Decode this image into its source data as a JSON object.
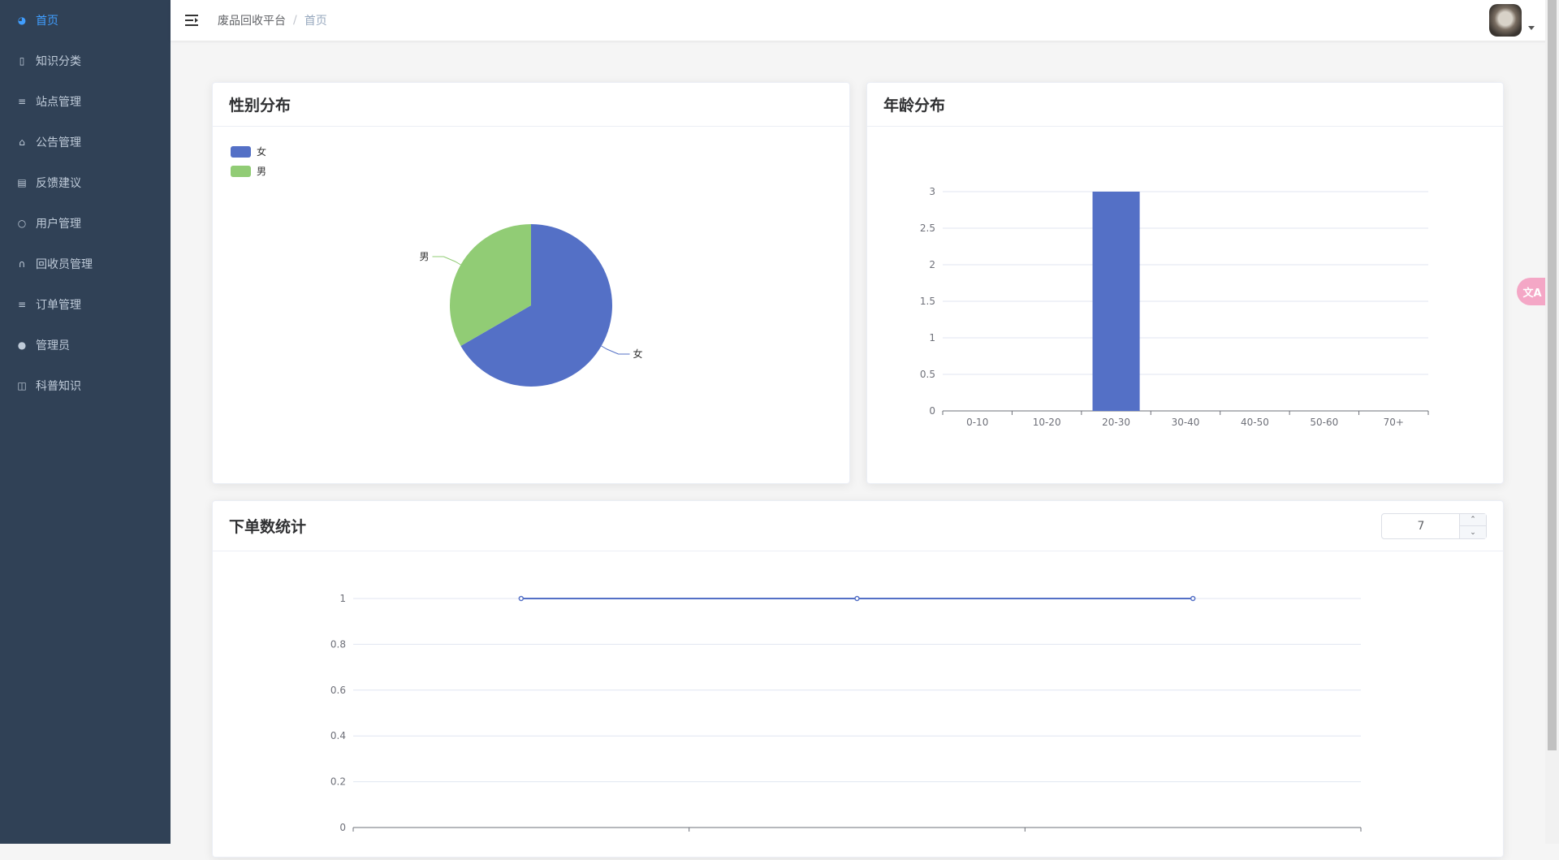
{
  "sidebar": {
    "items": [
      {
        "label": "首页",
        "icon": "dashboard-icon",
        "active": true
      },
      {
        "label": "知识分类",
        "icon": "book-icon",
        "active": false
      },
      {
        "label": "站点管理",
        "icon": "sliders-icon",
        "active": false
      },
      {
        "label": "公告管理",
        "icon": "box-icon",
        "active": false
      },
      {
        "label": "反馈建议",
        "icon": "message-icon",
        "active": false
      },
      {
        "label": "用户管理",
        "icon": "user-icon",
        "active": false
      },
      {
        "label": "回收员管理",
        "icon": "headset-icon",
        "active": false
      },
      {
        "label": "订单管理",
        "icon": "sliders-icon",
        "active": false
      },
      {
        "label": "管理员",
        "icon": "person-icon",
        "active": false
      },
      {
        "label": "科普知识",
        "icon": "open-book-icon",
        "active": false
      }
    ]
  },
  "header": {
    "breadcrumb": [
      "废品回收平台",
      "首页"
    ],
    "translate_badge": "文A"
  },
  "gender_card": {
    "title": "性别分布",
    "legend": [
      "女",
      "男"
    ]
  },
  "age_card": {
    "title": "年龄分布"
  },
  "orders_card": {
    "title": "下单数统计",
    "days_input": "7"
  },
  "colors": {
    "sidebar_bg": "#304156",
    "active": "#409eff",
    "series_blue": "#5470c6",
    "series_green": "#91cc75"
  },
  "chart_data": [
    {
      "type": "pie",
      "title": "性别分布",
      "categories": [
        "女",
        "男"
      ],
      "values": [
        2,
        1
      ],
      "legend": "top-left"
    },
    {
      "type": "bar",
      "title": "年龄分布",
      "categories": [
        "0-10",
        "10-20",
        "20-30",
        "30-40",
        "40-50",
        "50-60",
        "70+"
      ],
      "values": [
        0,
        0,
        3,
        0,
        0,
        0,
        0
      ],
      "ylim": [
        0,
        3
      ],
      "yticks": [
        "0",
        "0.5",
        "1",
        "1.5",
        "2",
        "2.5",
        "3"
      ],
      "grid": true
    },
    {
      "type": "line",
      "title": "下单数统计",
      "x": [
        "",
        "",
        ""
      ],
      "values": [
        1,
        1,
        1
      ],
      "ylim": [
        0,
        1
      ],
      "yticks": [
        "0",
        "0.2",
        "0.4",
        "0.6",
        "0.8",
        "1"
      ],
      "grid": true
    }
  ]
}
